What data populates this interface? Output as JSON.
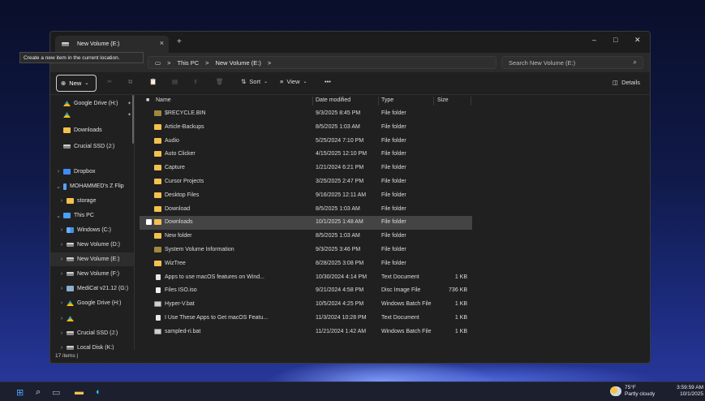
{
  "titlebar": {
    "tab_title": "New Volume (E:)",
    "tab_close": "×",
    "tab_add": "+",
    "minimize": "–",
    "maximize": "□",
    "close": "✕"
  },
  "tooltip": "Create a new item in the current location.",
  "address": {
    "crumbs": [
      "This PC",
      "New Volume (E:)"
    ],
    "separator": ">",
    "search_placeholder": "Search New Volume (E:)"
  },
  "toolbar": {
    "new_label": "New",
    "sort_label": "Sort",
    "view_label": "View",
    "more_label": "•••",
    "details_label": "Details"
  },
  "sidebar": [
    {
      "label": "Google Drive (H:)",
      "icon": "gdrive",
      "chev": "",
      "pin": true
    },
    {
      "label": "",
      "icon": "gdrive",
      "chev": "",
      "pin": true
    },
    {
      "label": "Downloads",
      "icon": "folder",
      "chev": ""
    },
    {
      "label": "Crucial SSD (J:)",
      "icon": "drive",
      "chev": ""
    },
    {
      "label": "Dropbox",
      "icon": "dropbox",
      "chev": ">"
    },
    {
      "label": "MOHAMMED's Z Flip",
      "icon": "phone",
      "chev": "v"
    },
    {
      "label": "storage",
      "icon": "folder",
      "chev": ">",
      "indent": 1
    },
    {
      "label": "This PC",
      "icon": "pc",
      "chev": "v"
    },
    {
      "label": "Windows (C:)",
      "icon": "win",
      "chev": ">",
      "indent": 1
    },
    {
      "label": "New Volume (D:)",
      "icon": "drive",
      "chev": ">",
      "indent": 1
    },
    {
      "label": "New Volume (E:)",
      "icon": "drive",
      "chev": ">",
      "indent": 1,
      "selected": true
    },
    {
      "label": "New Volume (F:)",
      "icon": "drive",
      "chev": ">",
      "indent": 1
    },
    {
      "label": "MediCat v21.12 (G:)",
      "icon": "medicat",
      "chev": ">",
      "indent": 1
    },
    {
      "label": "Google Drive (H:)",
      "icon": "gdrive",
      "chev": ">",
      "indent": 1
    },
    {
      "label": "",
      "icon": "gdrive",
      "chev": ">",
      "indent": 1
    },
    {
      "label": "Crucial SSD (J:)",
      "icon": "drive",
      "chev": ">",
      "indent": 1
    },
    {
      "label": "Local Disk (K:)",
      "icon": "drive",
      "chev": ">",
      "indent": 1
    }
  ],
  "columns": {
    "name": "Name",
    "date": "Date modified",
    "type": "Type",
    "size": "Size"
  },
  "files": [
    {
      "name": "$RECYCLE.BIN",
      "date": "9/3/2025 8:45 PM",
      "type": "File folder",
      "size": "",
      "icon": "sysfolder"
    },
    {
      "name": "Article-Backups",
      "date": "8/5/2025 1:03 AM",
      "type": "File folder",
      "size": "",
      "icon": "folder"
    },
    {
      "name": "Audio",
      "date": "5/25/2024 7:10 PM",
      "type": "File folder",
      "size": "",
      "icon": "folder"
    },
    {
      "name": "Auto Clicker",
      "date": "4/15/2025 12:10 PM",
      "type": "File folder",
      "size": "",
      "icon": "folder"
    },
    {
      "name": "Capture",
      "date": "1/21/2024 6:21 PM",
      "type": "File folder",
      "size": "",
      "icon": "folder"
    },
    {
      "name": "Cursor Projects",
      "date": "3/25/2025 2:47 PM",
      "type": "File folder",
      "size": "",
      "icon": "folder"
    },
    {
      "name": "Desktop Files",
      "date": "9/16/2025 12:11 AM",
      "type": "File folder",
      "size": "",
      "icon": "folder"
    },
    {
      "name": "Download",
      "date": "8/5/2025 1:03 AM",
      "type": "File folder",
      "size": "",
      "icon": "folder"
    },
    {
      "name": "Downloads",
      "date": "10/1/2025 1:48 AM",
      "type": "File folder",
      "size": "",
      "icon": "folder",
      "selected": true
    },
    {
      "name": "New folder",
      "date": "8/5/2025 1:03 AM",
      "type": "File folder",
      "size": "",
      "icon": "folder"
    },
    {
      "name": "System Volume Information",
      "date": "9/3/2025 3:46 PM",
      "type": "File folder",
      "size": "",
      "icon": "sysfolder"
    },
    {
      "name": "WizTree",
      "date": "8/28/2025 3:08 PM",
      "type": "File folder",
      "size": "",
      "icon": "folder"
    },
    {
      "name": "Apps to use macOS features on Wind...",
      "date": "10/30/2024 4:14 PM",
      "type": "Text Document",
      "size": "1 KB",
      "icon": "file"
    },
    {
      "name": "Files ISO.iso",
      "date": "9/21/2024 4:58 PM",
      "type": "Disc Image File",
      "size": "736 KB",
      "icon": "iso"
    },
    {
      "name": "Hyper-V.bat",
      "date": "10/5/2024 4:25 PM",
      "type": "Windows Batch File",
      "size": "1 KB",
      "icon": "bat"
    },
    {
      "name": "I Use These Apps to Get macOS Featu...",
      "date": "11/3/2024 10:28 PM",
      "type": "Text Document",
      "size": "1 KB",
      "icon": "file"
    },
    {
      "name": "sampled-ri.bat",
      "date": "11/21/2024 1:42 AM",
      "type": "Windows Batch File",
      "size": "1 KB",
      "icon": "bat"
    }
  ],
  "status": "17 items |",
  "taskbar": {
    "weather_temp": "75°F",
    "weather_desc": "Partly cloudy",
    "time": "3:59:59 AM",
    "date": "10/1/2025"
  }
}
